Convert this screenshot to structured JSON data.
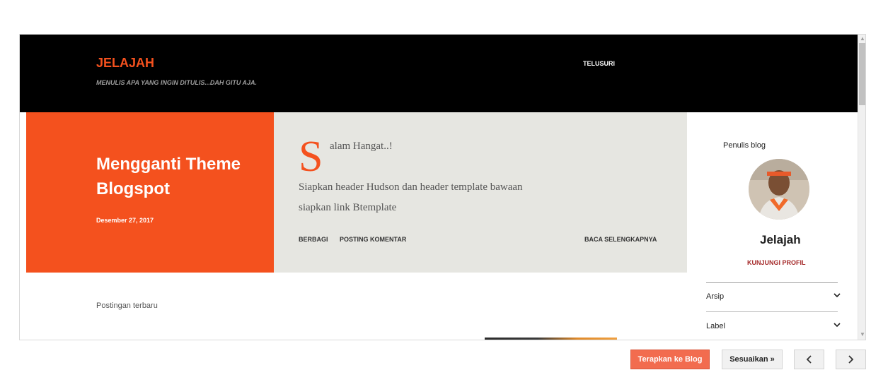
{
  "blog": {
    "title": "JELAJAH",
    "tagline": "MENULIS APA YANG INGIN DITULIS...DAH GITU AJA.",
    "nav_label": "TELUSURI"
  },
  "post": {
    "title": "Mengganti Theme Blogspot",
    "date": "Desember 27, 2017",
    "dropcap": "S",
    "snippet_first": "alam Hangat..!",
    "snippet_line2": "Siapkan header Hudson dan header template bawaan",
    "snippet_line3": "siapkan link Btemplate",
    "share_label": "BERBAGI",
    "comment_label": "POSTING KOMENTAR",
    "readmore_label": "BACA SELENGKAPNYA"
  },
  "recent": {
    "label": "Postingan terbaru"
  },
  "sidebar": {
    "author_section_label": "Penulis blog",
    "author_name": "Jelajah",
    "profile_link": "KUNJUNGI PROFIL",
    "archive_label": "Arsip",
    "label_label": "Label"
  },
  "footer": {
    "apply_label": "Terapkan ke Blog",
    "customize_label": "Sesuaikan »"
  },
  "colors": {
    "accent": "#f4511e",
    "header_bg": "#000000",
    "post_bg": "#e6e6e1",
    "profile_link": "#a52a2a",
    "apply_button": "#f26c4f"
  }
}
